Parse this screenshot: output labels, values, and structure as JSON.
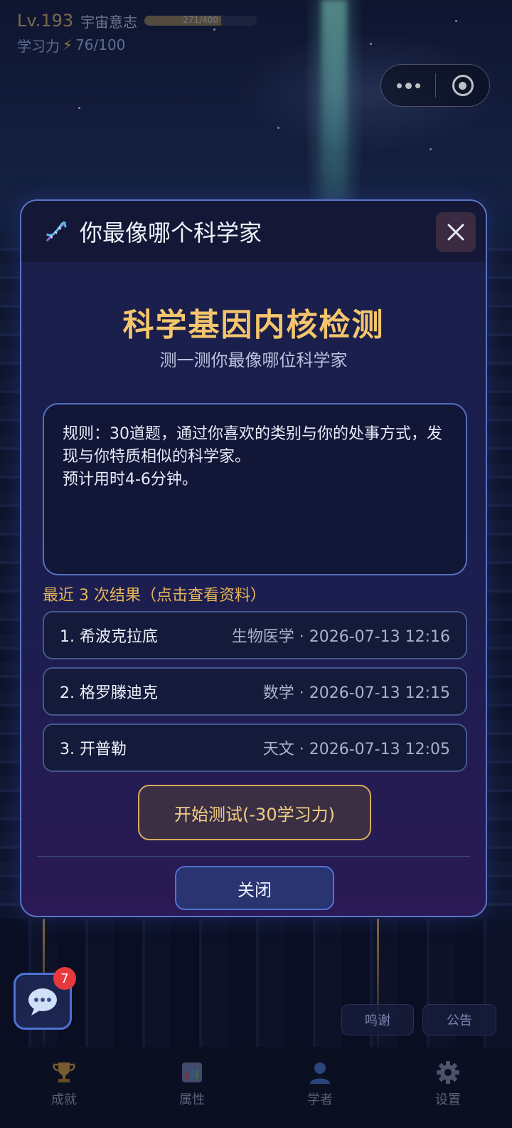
{
  "hud": {
    "level": "Lv.193",
    "title": "宇宙意志",
    "exp_text": "271/400",
    "exp_fraction": 0.68,
    "energy_label": "学习力",
    "energy_value": "76/100"
  },
  "modal": {
    "header_title": "你最像哪个科学家",
    "hero_title": "科学基因内核检测",
    "hero_subtitle": "测一测你最像哪位科学家",
    "rules": "规则：30道题，通过你喜欢的类别与你的处事方式，发现与你特质相似的科学家。\n预计用时4-6分钟。",
    "recent_title": "最近 3 次结果（点击查看资料）",
    "results": [
      {
        "name": "1. 希波克拉底",
        "meta": "生物医学 · 2026-07-13 12:16"
      },
      {
        "name": "2. 格罗滕迪克",
        "meta": "数学 · 2026-07-13 12:15"
      },
      {
        "name": "3. 开普勒",
        "meta": "天文 · 2026-07-13 12:05"
      }
    ],
    "start_label": "开始测试(-30学习力)",
    "close_label": "关闭"
  },
  "chat": {
    "badge": "7"
  },
  "side_buttons": {
    "thanks": "鸣谢",
    "notice": "公告"
  },
  "tabs": [
    {
      "label": "成就",
      "icon": "trophy-icon"
    },
    {
      "label": "属性",
      "icon": "bar-chart-icon"
    },
    {
      "label": "学者",
      "icon": "person-icon"
    },
    {
      "label": "设置",
      "icon": "gear-icon"
    }
  ],
  "colors": {
    "accent_gold": "#f4c56c",
    "frame_blue": "#5a74c6",
    "badge_red": "#e6393e"
  }
}
